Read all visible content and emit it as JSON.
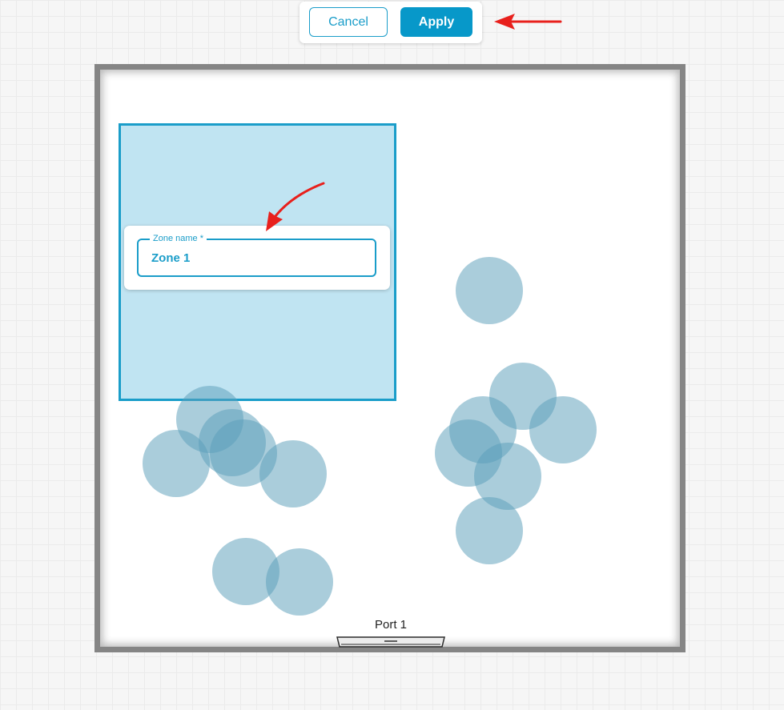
{
  "toolbar": {
    "cancel_label": "Cancel",
    "apply_label": "Apply"
  },
  "zone_dialog": {
    "field_label": "Zone name *",
    "value": "Zone 1"
  },
  "port": {
    "label": "Port 1"
  },
  "colors": {
    "accent": "#1a9dc9",
    "apply_fill": "#0798c9",
    "zone_fill": "#8ccee8",
    "target_fill": "#5ca0ba",
    "room_wall": "#858585",
    "annotation": "#e8201c"
  }
}
